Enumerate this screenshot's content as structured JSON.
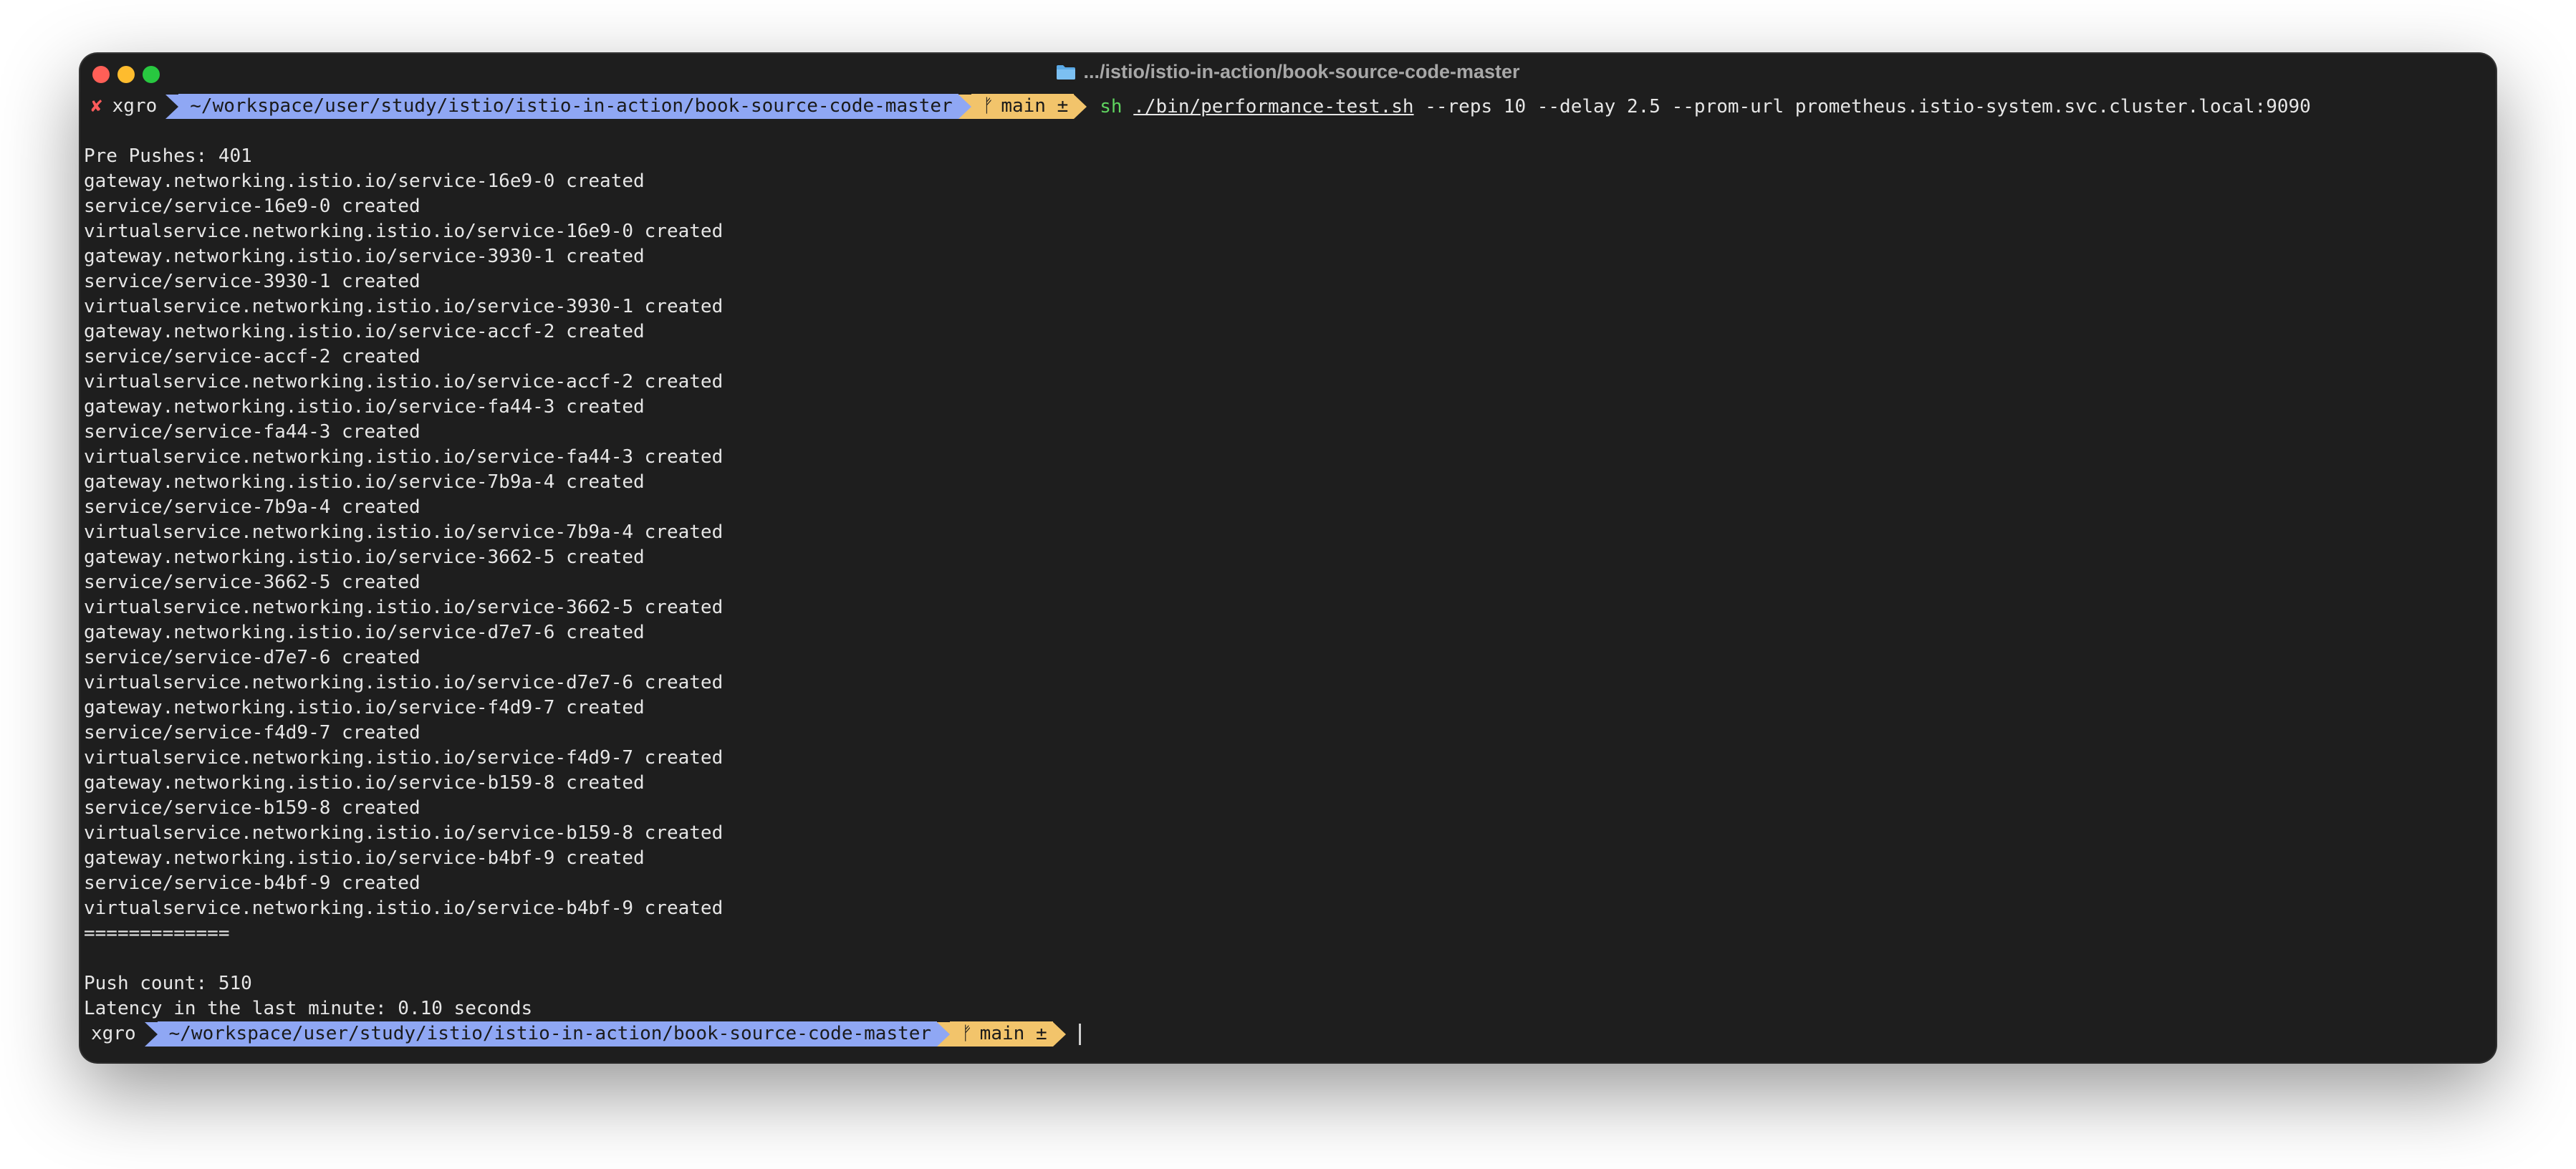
{
  "window": {
    "title": ".../istio/istio-in-action/book-source-code-master"
  },
  "prompt1": {
    "error_mark": "✘",
    "user": "xgro",
    "dir": "~/workspace/user/study/istio/istio-in-action/book-source-code-master",
    "branch_glyph": "ᚠ",
    "branch": "main ±",
    "cmd_name": "sh",
    "cmd_path": "./bin/performance-test.sh",
    "cmd_args": " --reps 10 --delay 2.5 --prom-url prometheus.istio-system.svc.cluster.local:9090"
  },
  "output": {
    "blank1": "",
    "pre_pushes": "Pre Pushes: 401",
    "lines": [
      "gateway.networking.istio.io/service-16e9-0 created",
      "service/service-16e9-0 created",
      "virtualservice.networking.istio.io/service-16e9-0 created",
      "gateway.networking.istio.io/service-3930-1 created",
      "service/service-3930-1 created",
      "virtualservice.networking.istio.io/service-3930-1 created",
      "gateway.networking.istio.io/service-accf-2 created",
      "service/service-accf-2 created",
      "virtualservice.networking.istio.io/service-accf-2 created",
      "gateway.networking.istio.io/service-fa44-3 created",
      "service/service-fa44-3 created",
      "virtualservice.networking.istio.io/service-fa44-3 created",
      "gateway.networking.istio.io/service-7b9a-4 created",
      "service/service-7b9a-4 created",
      "virtualservice.networking.istio.io/service-7b9a-4 created",
      "gateway.networking.istio.io/service-3662-5 created",
      "service/service-3662-5 created",
      "virtualservice.networking.istio.io/service-3662-5 created",
      "gateway.networking.istio.io/service-d7e7-6 created",
      "service/service-d7e7-6 created",
      "virtualservice.networking.istio.io/service-d7e7-6 created",
      "gateway.networking.istio.io/service-f4d9-7 created",
      "service/service-f4d9-7 created",
      "virtualservice.networking.istio.io/service-f4d9-7 created",
      "gateway.networking.istio.io/service-b159-8 created",
      "service/service-b159-8 created",
      "virtualservice.networking.istio.io/service-b159-8 created",
      "gateway.networking.istio.io/service-b4bf-9 created",
      "service/service-b4bf-9 created",
      "virtualservice.networking.istio.io/service-b4bf-9 created"
    ],
    "separator": "=============",
    "push_count": "Push count: 510",
    "latency": "Latency in the last minute: 0.10 seconds"
  },
  "prompt2": {
    "user": "xgro",
    "dir": "~/workspace/user/study/istio/istio-in-action/book-source-code-master",
    "branch_glyph": "ᚠ",
    "branch": "main ±"
  },
  "colors": {
    "background": "#1e1e1e",
    "dir_segment": "#8fa7f4",
    "git_segment": "#f2c46b",
    "command": "#5fd35f",
    "error": "#ff5b5b"
  }
}
